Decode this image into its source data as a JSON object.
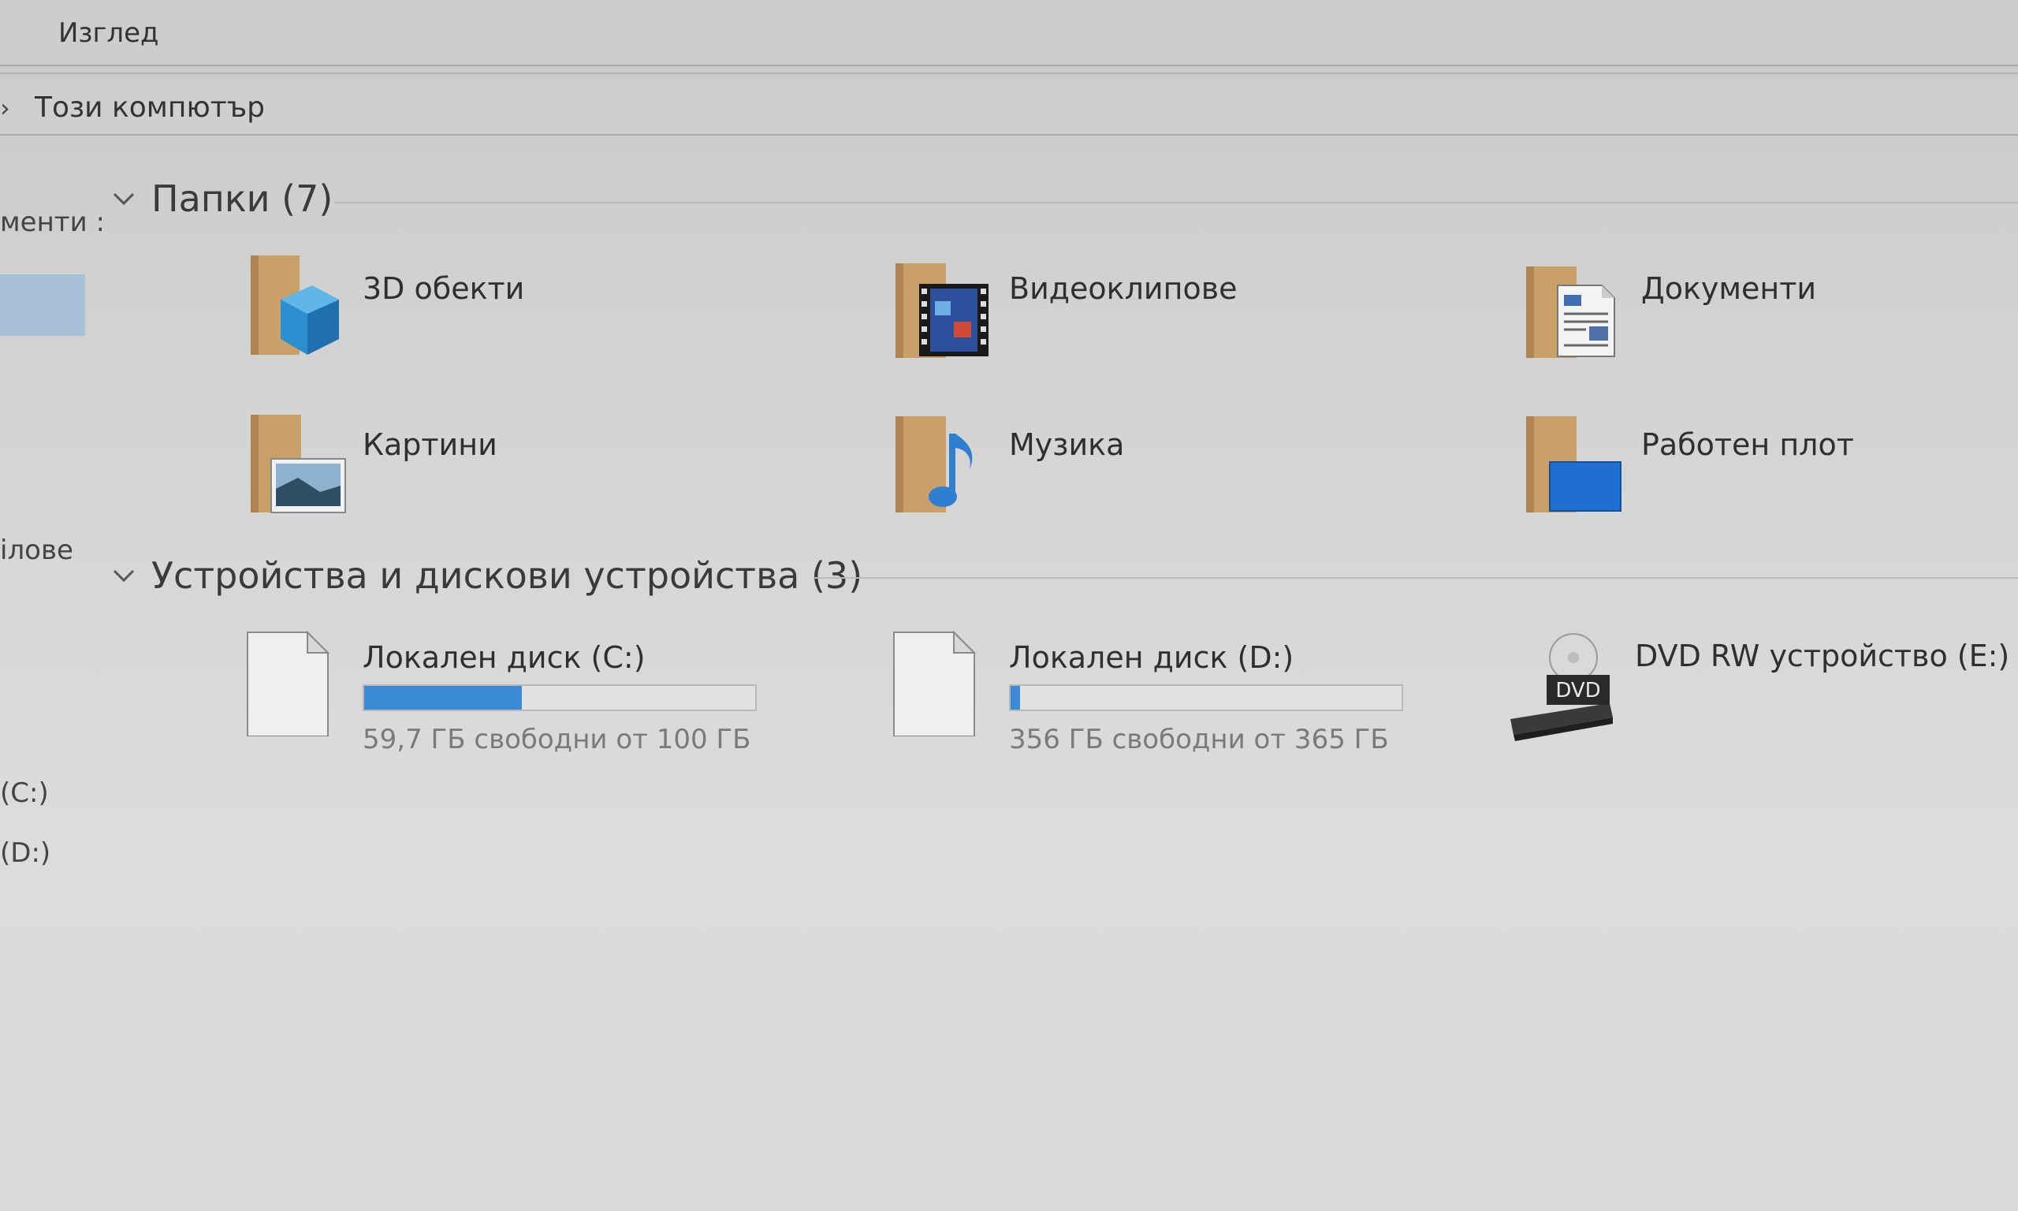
{
  "ribbon": {
    "view_tab": "Изглед"
  },
  "address": {
    "crumb": "Този компютър"
  },
  "nav": {
    "items": [
      {
        "label": "менти :"
      },
      {
        "label": "iлове"
      },
      {
        "label": "(C:)"
      },
      {
        "label": "(D:)"
      }
    ]
  },
  "sections": {
    "folders": {
      "title": "Папки (7)"
    },
    "devices": {
      "title": "Устройства и дискови устройства (3)"
    }
  },
  "folders": [
    {
      "label": "3D обекти",
      "icon": "3d-objects-folder-icon"
    },
    {
      "label": "Видеоклипове",
      "icon": "videos-folder-icon"
    },
    {
      "label": "Документи",
      "icon": "documents-folder-icon"
    },
    {
      "label": "Картини",
      "icon": "pictures-folder-icon"
    },
    {
      "label": "Музика",
      "icon": "music-folder-icon"
    },
    {
      "label": "Работен плот",
      "icon": "desktop-folder-icon"
    }
  ],
  "drives": [
    {
      "label": "Локален диск (C:)",
      "free_text": "59,7 ГБ свободни от 100 ГБ",
      "used_fraction": 0.403,
      "icon": "drive-icon"
    },
    {
      "label": "Локален диск (D:)",
      "free_text": "356 ГБ свободни от 365 ГБ",
      "used_fraction": 0.025,
      "icon": "drive-icon"
    },
    {
      "label": "DVD RW устройство (E:)",
      "icon": "dvd-drive-icon",
      "icon_text": "DVD"
    }
  ],
  "colors": {
    "accent": "#3b8ad6",
    "selection": "#a9c1d8"
  }
}
